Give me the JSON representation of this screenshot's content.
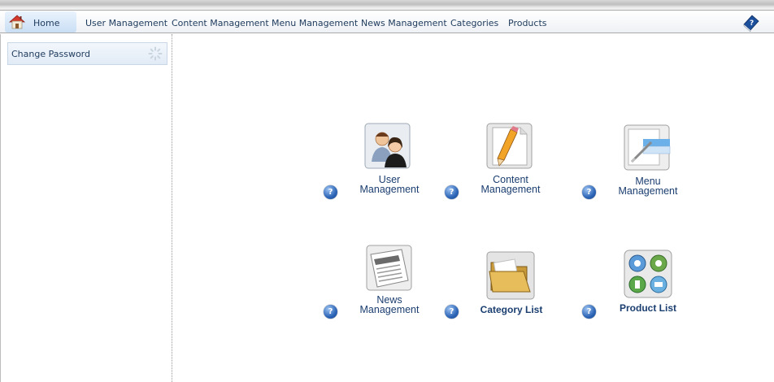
{
  "navbar": {
    "home_label": "Home",
    "items": [
      "User Management",
      "Content Management",
      "Menu Management",
      "News Management",
      "Categories",
      "Products"
    ],
    "home_icon": "house-icon",
    "help_icon": "help-book-icon"
  },
  "sidebar": {
    "items": [
      {
        "label": "Change Password",
        "icon": "spinner-icon"
      }
    ]
  },
  "dashboard": {
    "tiles": [
      {
        "line1": "User",
        "line2": "Management",
        "icon": "users-icon"
      },
      {
        "line1": "Content",
        "line2": "Management",
        "icon": "pencil-document-icon"
      },
      {
        "line1": "Menu",
        "line2": "Management",
        "icon": "menu-window-icon"
      },
      {
        "line1": "News",
        "line2": "Management",
        "icon": "newspaper-icon"
      },
      {
        "line1": "Category List",
        "line2": "",
        "icon": "folder-icon"
      },
      {
        "line1": "Product List",
        "line2": "",
        "icon": "product-apps-icon"
      }
    ],
    "help_label": "?"
  }
}
